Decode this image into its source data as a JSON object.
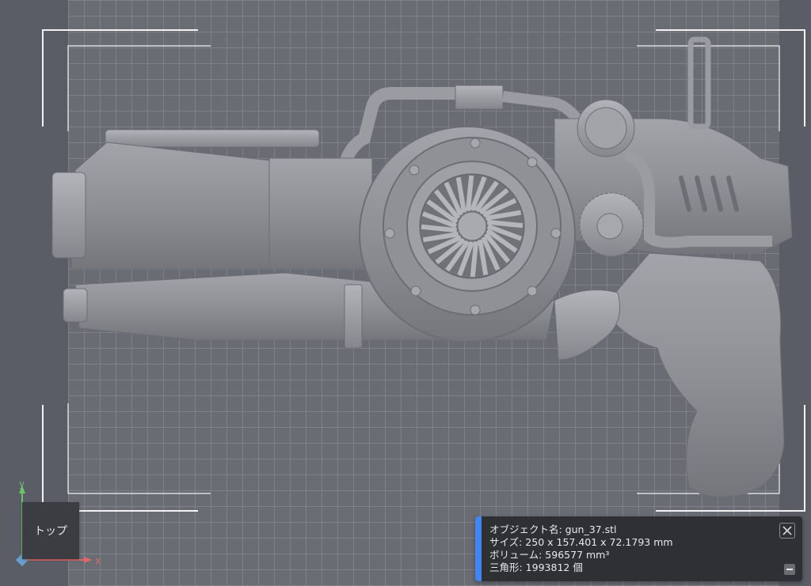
{
  "viewport": {
    "view_label": "トップ",
    "axes": {
      "x": "x",
      "y": "y"
    },
    "colors": {
      "background": "#5b5d66",
      "plate": "#6a6c74",
      "model": "#8d8f96",
      "x_axis": "#e06a6a",
      "y_axis": "#6ac46a",
      "accent": "#3f86f4"
    }
  },
  "info_panel": {
    "object_name": "オブジェクト名: gun_37.stl",
    "size": "サイズ: 250 x 157.401 x 72.1793 mm",
    "volume": "ボリューム: 596577 mm³",
    "triangles": "三角形: 1993812 個",
    "close_icon": "close-icon",
    "collapse_icon": "minus-icon"
  }
}
